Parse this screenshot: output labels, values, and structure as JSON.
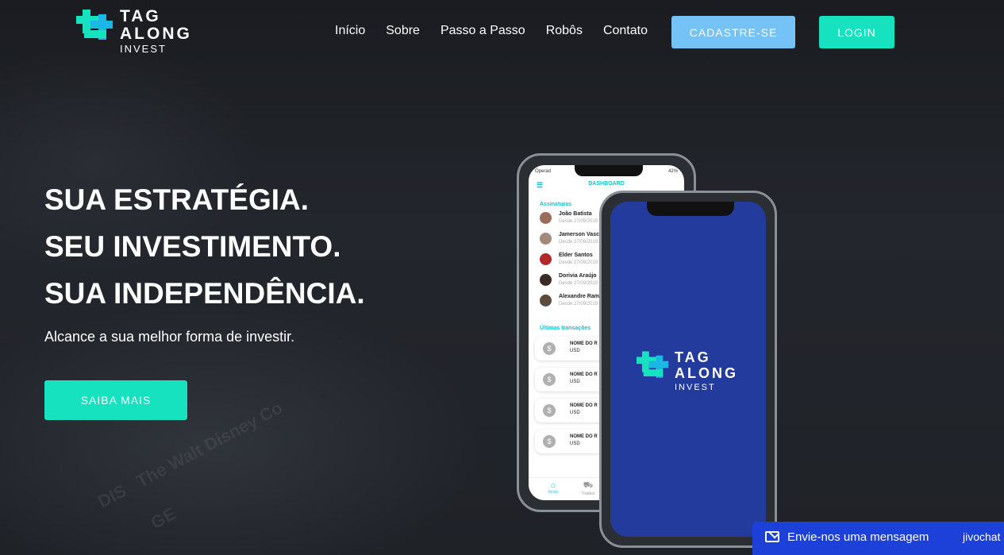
{
  "header": {
    "logo_line1": "TAG",
    "logo_line2": "ALONG",
    "logo_sub": "INVEST",
    "nav": [
      "Início",
      "Sobre",
      "Passo a Passo",
      "Robôs",
      "Contato"
    ],
    "signup_label": "CADASTRE-SE",
    "login_label": "LOGIN"
  },
  "hero": {
    "line1": "SUA ESTRATÉGIA.",
    "line2": "SEU INVESTIMENTO.",
    "line3": "SUA INDEPENDÊNCIA.",
    "subtitle": "Alcance a sua melhor forma de investir.",
    "cta_label": "SAIBA MAIS"
  },
  "app_preview": {
    "carrier": "Operad",
    "battery": "42%",
    "screen_title": "DASHBOARD",
    "subs_title": "Assinaturas",
    "subscribers": [
      {
        "name": "João Batista",
        "since": "Desde 27/09/2019"
      },
      {
        "name": "Jamerson Vasc",
        "since": "Desde 27/09/2019"
      },
      {
        "name": "Elder Santos",
        "since": "Desde 27/09/2019"
      },
      {
        "name": "Dorivia Araújo",
        "since": "Desde 27/09/2019"
      },
      {
        "name": "Alexandre Rami",
        "since": "Desde 27/09/2019"
      }
    ],
    "tx_title": "Últimas transações",
    "transactions": [
      {
        "name": "NOME DO R",
        "currency": "USD"
      },
      {
        "name": "NOME DO R",
        "currency": "USD"
      },
      {
        "name": "NOME DO R",
        "currency": "USD"
      },
      {
        "name": "NOME DO R",
        "currency": "USD"
      }
    ],
    "tab_home": "Início",
    "tab_traders": "Traders",
    "splash_line1": "TAG",
    "splash_line2": "ALONG",
    "splash_sub": "INVEST"
  },
  "chat": {
    "label": "Envie-nos uma mensagem",
    "brand": "jivochat"
  },
  "colors": {
    "accent": "#16e2c0",
    "signup": "#75c2f7",
    "app_blue": "#243b9e",
    "chat_blue": "#1c40d8"
  }
}
